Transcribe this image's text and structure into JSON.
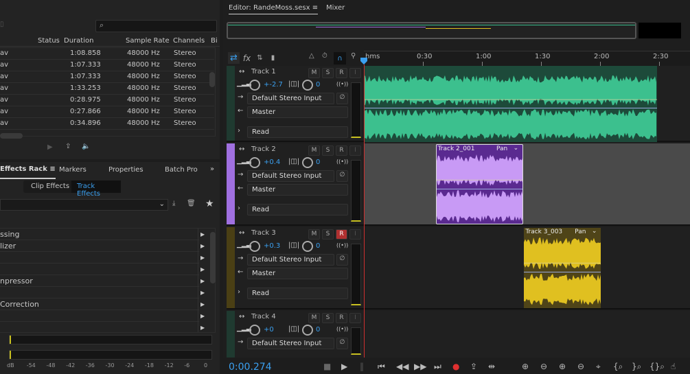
{
  "files": {
    "columns": [
      "Status",
      "Duration",
      "Sample Rate",
      "Channels",
      "Bi"
    ],
    "rows": [
      {
        "name": "av",
        "duration": "1:08.858",
        "rate": "48000 Hz",
        "channels": "Stereo"
      },
      {
        "name": "av",
        "duration": "1:07.333",
        "rate": "48000 Hz",
        "channels": "Stereo"
      },
      {
        "name": "av",
        "duration": "1:07.333",
        "rate": "48000 Hz",
        "channels": "Stereo"
      },
      {
        "name": "av",
        "duration": "1:33.253",
        "rate": "48000 Hz",
        "channels": "Stereo"
      },
      {
        "name": "av",
        "duration": "0:28.975",
        "rate": "48000 Hz",
        "channels": "Stereo"
      },
      {
        "name": "av",
        "duration": "0:27.866",
        "rate": "48000 Hz",
        "channels": "Stereo"
      },
      {
        "name": "av",
        "duration": "0:34.896",
        "rate": "48000 Hz",
        "channels": "Stereo"
      }
    ]
  },
  "effects": {
    "tabs": [
      "Effects Rack",
      "Markers",
      "Properties",
      "Batch Pro"
    ],
    "subtabs": [
      "Clip Effects",
      "Track Effects"
    ],
    "items": [
      "ssing",
      "lizer",
      "",
      "",
      "npressor",
      "",
      "Correction",
      "",
      ""
    ],
    "db_scale": [
      "dB",
      "-54",
      "-48",
      "-42",
      "-36",
      "-30",
      "-24",
      "-18",
      "-12",
      "-6",
      "0"
    ]
  },
  "editor": {
    "tabs": [
      "Editor: RandeMoss.sesx",
      "Mixer"
    ],
    "ruler": [
      "hms",
      "0:30",
      "1:00",
      "1:30",
      "2:00",
      "2:30"
    ],
    "tracks": [
      {
        "name": "Track 1",
        "volume": "+-2.7",
        "pan": "0",
        "input": "Default Stereo Input",
        "output": "Master",
        "mode": "Read",
        "color": "#1f3a30",
        "armed": false
      },
      {
        "name": "Track 2",
        "volume": "+0.4",
        "pan": "0",
        "input": "Default Stereo Input",
        "output": "Master",
        "mode": "Read",
        "color": "#a070e0",
        "armed": false
      },
      {
        "name": "Track 3",
        "volume": "+0.3",
        "pan": "0",
        "input": "Default Stereo Input",
        "output": "Master",
        "mode": "Read",
        "color": "#4a3f14",
        "armed": true
      },
      {
        "name": "Track 4",
        "volume": "+0",
        "pan": "0",
        "input": "Default Stereo Input",
        "output": "",
        "mode": "",
        "color": "#1f3a30",
        "armed": false
      }
    ],
    "clips": [
      {
        "track": 0,
        "name": "",
        "start": 0,
        "end": 149,
        "wave": "#3cc08e",
        "bg": "#1d4a3a"
      },
      {
        "track": 1,
        "name": "Track 2_001",
        "pan": "Pan",
        "start": 36.5,
        "end": 81,
        "wave": "#c89af5",
        "bg": "#5a2a90"
      },
      {
        "track": 2,
        "name": "Track 3_003",
        "pan": "Pan",
        "start": 81.4,
        "end": 120.5,
        "wave": "#e0c020",
        "bg": "#4f4418"
      }
    ],
    "time": "0:00.274"
  }
}
